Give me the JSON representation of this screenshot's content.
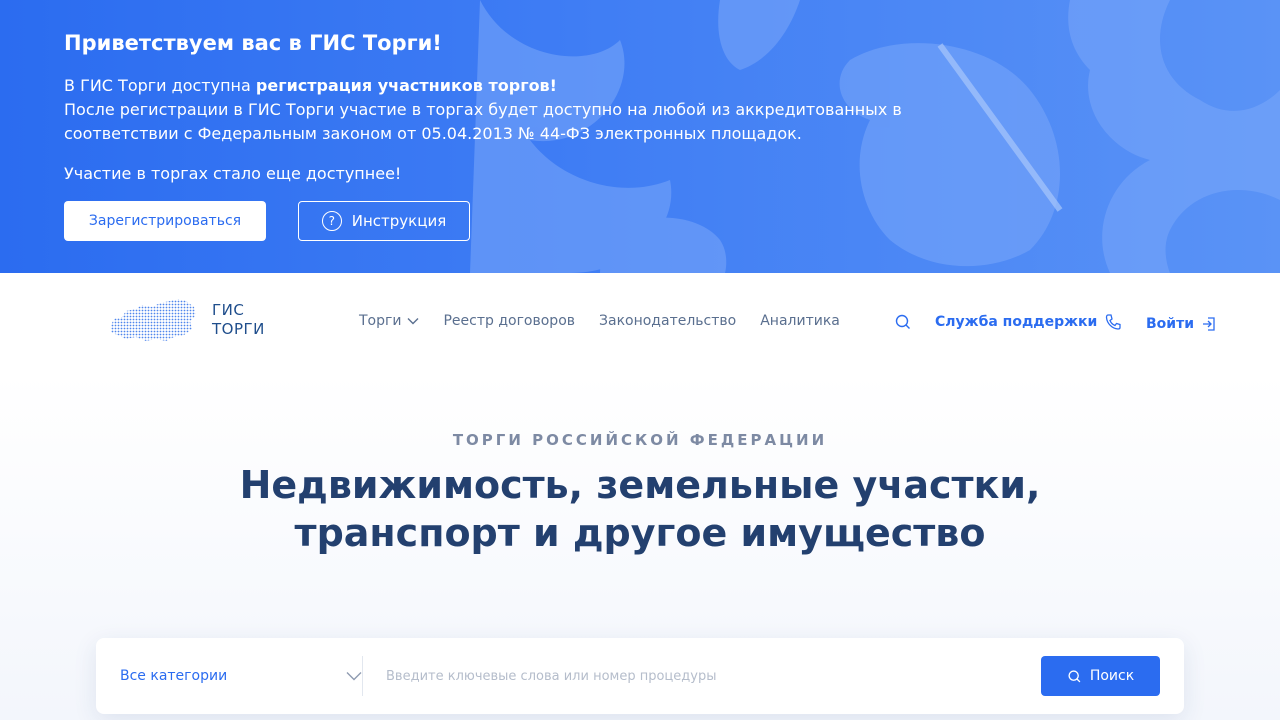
{
  "banner": {
    "title": "Приветствуем вас в ГИС Торги!",
    "line1_prefix": "В ГИС Торги доступна ",
    "line1_bold": "регистрация участников торгов!",
    "line2": "После регистрации в ГИС Торги участие в торгах будет доступно на любой из аккредитованных в соответствии с Федеральным законом от 05.04.2013 № 44-ФЗ электронных площадок.",
    "subtitle": "Участие в торгах стало еще доступнее!",
    "register_label": "Зарегистрироваться",
    "instruction_label": "Инструкция",
    "instruction_icon": "?"
  },
  "header": {
    "logo_line1": "ГИС",
    "logo_line2": "ТОРГИ",
    "nav": [
      {
        "label": "Торги"
      },
      {
        "label": "Реестр договоров"
      },
      {
        "label": "Законодательство"
      },
      {
        "label": "Аналитика"
      }
    ],
    "support_label": "Служба поддержки",
    "login_label": "Войти"
  },
  "hero": {
    "kicker": "ТОРГИ РОССИЙСКОЙ ФЕДЕРАЦИИ",
    "title_line1": "Недвижимость, земельные участки,",
    "title_line2": "транспорт и другое имущество"
  },
  "search": {
    "category_value": "Все категории",
    "placeholder": "Введите ключевые слова или номер процедуры",
    "button_label": "Поиск"
  },
  "colors": {
    "accent": "#2b6cf0",
    "title": "#23406f",
    "nav": "#5a6f8f"
  }
}
